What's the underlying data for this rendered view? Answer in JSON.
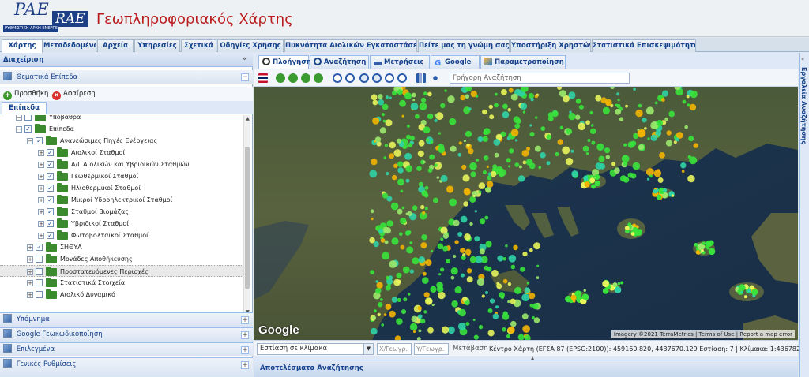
{
  "header": {
    "logo_main": "PAE",
    "logo_secondary": "RAE",
    "logo_band": "ΡΥΘΜΙΣΤΙΚΗ ΑΡΧΗ ΕΝΕΡΓΕΙΑΣ",
    "title": "Γεωπληροφοριακός Χάρτης"
  },
  "main_tabs": [
    "Χάρτης",
    "Μεταδεδομένα",
    "Αρχεία",
    "Υπηρεσίες",
    "Σχετικά",
    "Οδηγίες Χρήσης",
    "Πυκνότητα Αιολικών Εγκαταστάσεων",
    "Πείτε μας τη γνώμη σας",
    "Υποστήριξη Χρηστών",
    "Στατιστικά Επισκεψιμότητας"
  ],
  "left": {
    "panel_title": "Διαχείριση",
    "panel_toggle": "«",
    "thematic_title": "Θεματικά Επίπεδα",
    "thematic_toggle": "−",
    "add_label": "Προσθήκη",
    "remove_label": "Αφαίρεση",
    "subtab": "Επίπεδα",
    "tree": [
      {
        "label": "Υποβάθρα",
        "depth": 1,
        "checked": false,
        "exp": "−"
      },
      {
        "label": "Επίπεδα",
        "depth": 1,
        "checked": true,
        "exp": "−"
      },
      {
        "label": "Ανανεώσιμες Πηγές Ενέργειας",
        "depth": 2,
        "checked": true,
        "exp": "−"
      },
      {
        "label": "Αιολικοί Σταθμοί",
        "depth": 3,
        "checked": true,
        "exp": "+"
      },
      {
        "label": "Α/Γ Αιολικών και Υβριδικών Σταθμών",
        "depth": 3,
        "checked": true,
        "exp": "+"
      },
      {
        "label": "Γεωθερμικοί Σταθμοί",
        "depth": 3,
        "checked": true,
        "exp": "+"
      },
      {
        "label": "Ηλιοθερμικοί Σταθμοί",
        "depth": 3,
        "checked": true,
        "exp": "+"
      },
      {
        "label": "Μικροί Υδροηλεκτρικοί Σταθμοί",
        "depth": 3,
        "checked": true,
        "exp": "+"
      },
      {
        "label": "Σταθμοί Βιομάζας",
        "depth": 3,
        "checked": true,
        "exp": "+"
      },
      {
        "label": "Υβριδικοί Σταθμοί",
        "depth": 3,
        "checked": true,
        "exp": "+"
      },
      {
        "label": "Φωτοβολταϊκοί Σταθμοί",
        "depth": 3,
        "checked": true,
        "exp": "+"
      },
      {
        "label": "ΣΗΘΥΑ",
        "depth": 2,
        "checked": true,
        "exp": "+"
      },
      {
        "label": "Μονάδες Αποθήκευσης",
        "depth": 2,
        "checked": false,
        "exp": "+"
      },
      {
        "label": "Προστατευόμενες Περιοχές",
        "depth": 2,
        "checked": false,
        "exp": "+",
        "highlight": true
      },
      {
        "label": "Στατιστικά Στοιχεία",
        "depth": 2,
        "checked": false,
        "exp": "+"
      },
      {
        "label": "Αιολικό Δυναμικό",
        "depth": 2,
        "checked": false,
        "exp": "+"
      }
    ],
    "collapsed_panels": [
      {
        "label": "Υπόμνημα",
        "toggle": "+"
      },
      {
        "label": "Google Γεωκωδικοποίηση",
        "toggle": "+"
      },
      {
        "label": "Επιλεγμένα",
        "toggle": "+"
      },
      {
        "label": "Γενικές Ρυθμίσεις",
        "toggle": "+"
      }
    ]
  },
  "map_tabs": [
    "Πλοήγηση",
    "Αναζήτηση",
    "Μετρήσεις",
    "Google",
    "Παραμετροποίηση"
  ],
  "map_toolbar": {
    "search_placeholder": "Γρήγορη Αναζήτηση"
  },
  "map": {
    "provider": "Google",
    "attribution": [
      "Imagery ©2021 TerraMetrics",
      "Terms of Use",
      "Report a map error"
    ]
  },
  "status": {
    "scale_placeholder": "Εστίαση σε κλίμακα",
    "x_placeholder": "Χ/Γεωγρ.",
    "y_placeholder": "Υ/Γεωγρ.",
    "go_label": "Μετάβαση",
    "center_text": "Κέντρο Χάρτη (ΕΓΣΑ 87 (EPSG:2100)): 459160.820, 4437670.129 Εστίαση: 7 | Κλίμακα: 1:4367821 |"
  },
  "results_title": "Αποτελέσματα Αναζήτησης",
  "right_strip_label": "Εργαλεία Αναζήτησης",
  "right_strip_toggle": "«",
  "colors": {
    "accent": "#15428b",
    "title_red": "#b91c1c",
    "logo_blue": "#1d3f86",
    "marker_green": "#39e33b",
    "marker_yellow": "#f2b400",
    "marker_teal": "#2fd3a6"
  }
}
